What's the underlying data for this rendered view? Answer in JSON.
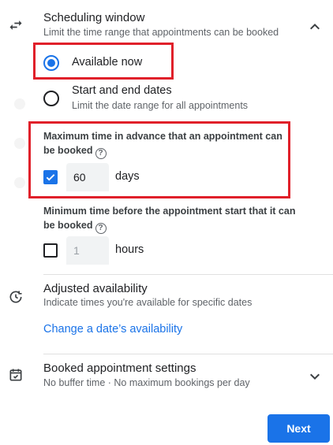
{
  "scheduling_window": {
    "title": "Scheduling window",
    "subtitle": "Limit the time range that appointments can be booked",
    "icon": "swap-arrows-icon",
    "collapse_icon": "chevron-up-icon",
    "options": [
      {
        "label": "Available now",
        "sublabel": "",
        "selected": true
      },
      {
        "label": "Start and end dates",
        "sublabel": "Limit the date range for all appointments",
        "selected": false
      }
    ],
    "max_advance": {
      "label": "Maximum time in advance that an appointment can be booked",
      "checked": true,
      "value": "60",
      "unit": "days"
    },
    "min_before": {
      "label": "Minimum time before the appointment start that it can be booked",
      "checked": false,
      "value": "1",
      "unit": "hours"
    },
    "help_glyph": "?"
  },
  "adjusted_availability": {
    "title": "Adjusted availability",
    "subtitle": "Indicate times you're available for specific dates",
    "link": "Change a date’s availability",
    "icon": "calendar-refresh-icon"
  },
  "booked_settings": {
    "title": "Booked appointment settings",
    "subtitle": "No buffer time · No maximum bookings per day",
    "icon": "calendar-check-icon",
    "expand_icon": "chevron-down-icon"
  },
  "footer": {
    "next_label": "Next"
  },
  "colors": {
    "accent": "#1a73e8",
    "highlight": "#e0202a"
  }
}
